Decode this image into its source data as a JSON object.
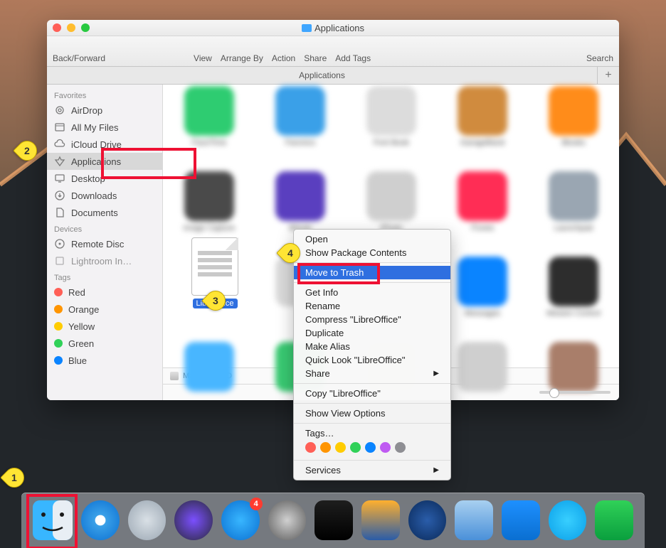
{
  "window": {
    "title": "Applications",
    "back_forward": "Back/Forward",
    "toolbar": {
      "view": "View",
      "arrange": "Arrange By",
      "action": "Action",
      "share": "Share",
      "tags": "Add Tags",
      "search": "Search"
    },
    "tab": "Applications",
    "newtab": "+"
  },
  "sidebar": {
    "favorites_head": "Favorites",
    "favorites": [
      {
        "label": "AirDrop",
        "icon": "airdrop"
      },
      {
        "label": "All My Files",
        "icon": "allfiles"
      },
      {
        "label": "iCloud Drive",
        "icon": "cloud"
      },
      {
        "label": "Applications",
        "icon": "apps",
        "selected": true
      },
      {
        "label": "Desktop",
        "icon": "desktop"
      },
      {
        "label": "Downloads",
        "icon": "downloads"
      },
      {
        "label": "Documents",
        "icon": "documents"
      }
    ],
    "devices_head": "Devices",
    "devices": [
      {
        "label": "Remote Disc",
        "icon": "disc"
      },
      {
        "label": "Lightroom In…",
        "icon": "disk",
        "dim": true
      }
    ],
    "tags_head": "Tags",
    "tags": [
      {
        "label": "Red",
        "color": "#ff5f56"
      },
      {
        "label": "Orange",
        "color": "#ff9500"
      },
      {
        "label": "Yellow",
        "color": "#ffcc00"
      },
      {
        "label": "Green",
        "color": "#30d158"
      },
      {
        "label": "Blue",
        "color": "#0a84ff"
      }
    ]
  },
  "grid": {
    "row1": [
      {
        "label": "FaceTime",
        "bg": "#2ecc71"
      },
      {
        "label": "Faronics",
        "bg": "#3aa0e8"
      },
      {
        "label": "Font Book",
        "bg": "#dcdcdc"
      },
      {
        "label": "GarageBand",
        "bg": "#d08b3e"
      },
      {
        "label": "iBooks",
        "bg": "#ff8c1a"
      }
    ],
    "row2": [
      {
        "label": "Image Capture",
        "bg": "#4a4a4a"
      },
      {
        "label": "iMovie",
        "bg": "#5a3fbf"
      },
      {
        "label": "iPhoto",
        "bg": "#cfcfcf"
      },
      {
        "label": "iTunes",
        "bg": "#ff2d55"
      },
      {
        "label": "Launchpad",
        "bg": "#9aa6b2"
      }
    ],
    "row3": [
      {
        "label": "",
        "bg": "#ffffff"
      },
      {
        "label": "",
        "bg": "#dadada"
      },
      {
        "label": "",
        "bg": "#f3f3f3"
      },
      {
        "label": "Messages",
        "bg": "#0a84ff"
      },
      {
        "label": "Mission Control",
        "bg": "#2d2d2d"
      }
    ],
    "row4": [
      {
        "label": "",
        "bg": "#48b6ff"
      },
      {
        "label": "",
        "bg": "#39c972"
      },
      {
        "label": "",
        "bg": "#dfefc0"
      },
      {
        "label": "",
        "bg": "#cfcfcf"
      },
      {
        "label": "",
        "bg": "#a97e6a"
      }
    ]
  },
  "selected_app": {
    "label": "LibreOffice"
  },
  "pathbar": {
    "disk": "Macintosh HD"
  },
  "context": {
    "items1": [
      "Open",
      "Show Package Contents"
    ],
    "sel": "Move to Trash",
    "items2": [
      "Get Info",
      "Rename",
      "Compress \"LibreOffice\"",
      "Duplicate",
      "Make Alias",
      "Quick Look \"LibreOffice\""
    ],
    "share": "Share",
    "copy": "Copy \"LibreOffice\"",
    "viewopts": "Show View Options",
    "tags": "Tags…",
    "tag_colors": [
      "#ff5f56",
      "#ff9500",
      "#ffcc00",
      "#30d158",
      "#0a84ff",
      "#bf5af2",
      "#8e8e93"
    ],
    "services": "Services"
  },
  "markers": {
    "1": "1",
    "2": "2",
    "3": "3",
    "4": "4"
  },
  "dock": {
    "items": [
      {
        "name": "finder",
        "bg": "linear-gradient(#38b6ff,#0a6fd1)"
      },
      {
        "name": "safari",
        "bg": "radial-gradient(circle,#fff 18%,#3aa0e8 20%,#0a6fd1 100%)",
        "round": true
      },
      {
        "name": "launchpad",
        "bg": "radial-gradient(circle,#d9e0e6,#9aa6b2)",
        "round": true
      },
      {
        "name": "siri",
        "bg": "radial-gradient(circle,#7b4fff,#2a2a3a)",
        "round": true
      },
      {
        "name": "appstore",
        "bg": "radial-gradient(circle,#38b6ff,#0a6fd1)",
        "round": true,
        "badge": "4"
      },
      {
        "name": "settings",
        "bg": "radial-gradient(circle,#d0d0d0,#5a5a5a)",
        "round": true
      },
      {
        "name": "activity",
        "bg": "linear-gradient(#1e1e1e,#000)"
      },
      {
        "name": "display",
        "bg": "linear-gradient(#ffb02e,#2a5ca8)"
      },
      {
        "name": "quicktime",
        "bg": "radial-gradient(circle,#2a5daa,#0a2a5a)",
        "round": true
      },
      {
        "name": "preview",
        "bg": "linear-gradient(#a8d0f0,#4a90d9)"
      },
      {
        "name": "xcode",
        "bg": "linear-gradient(#1e90ff,#0a6fd1)"
      },
      {
        "name": "messages",
        "bg": "radial-gradient(circle,#38cfff,#0a9fe8)",
        "round": true
      },
      {
        "name": "facetime",
        "bg": "linear-gradient(#30d158,#0a9f3e)"
      }
    ]
  }
}
